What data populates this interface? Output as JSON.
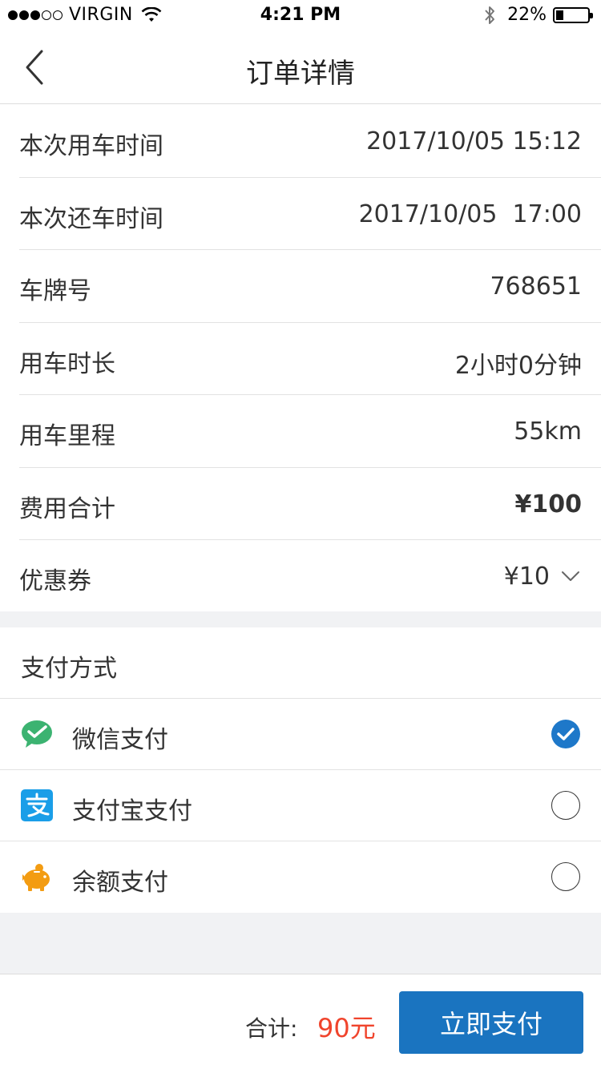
{
  "status_bar": {
    "carrier": "VIRGIN",
    "time": "4:21 PM",
    "battery_text": "22%",
    "signal_bars_filled": 3,
    "signal_bars_total": 5
  },
  "nav": {
    "title": "订单详情",
    "back_icon": "chevron-left-icon"
  },
  "details": {
    "rows": [
      {
        "label": "本次用车时间",
        "value": "2017/10/05 15:12"
      },
      {
        "label": "本次还车时间",
        "value": "2017/10/05  17:00"
      },
      {
        "label": "车牌号",
        "value": "768651"
      },
      {
        "label": "用车时长",
        "value": "2小时0分钟"
      },
      {
        "label": "用车里程",
        "value": "55km"
      },
      {
        "label": "费用合计",
        "value": "¥100"
      },
      {
        "label": "优惠券",
        "value": "¥10"
      }
    ]
  },
  "payment": {
    "title": "支付方式",
    "methods": [
      {
        "label": "微信支付",
        "icon": "wechat-pay-icon",
        "selected": true
      },
      {
        "label": "支付宝支付",
        "icon": "alipay-icon",
        "selected": false
      },
      {
        "label": "余额支付",
        "icon": "piggy-bank-icon",
        "selected": false
      }
    ]
  },
  "footer": {
    "total_label": "合计:",
    "total_value": "90元",
    "pay_button": "立即支付"
  },
  "colors": {
    "accent": "#1a74c0",
    "price_red": "#f0442c",
    "wechat_green": "#3cb371",
    "alipay_blue": "#1a9ee8",
    "balance_orange": "#f39c12",
    "gap_gray": "#f1f2f4"
  }
}
